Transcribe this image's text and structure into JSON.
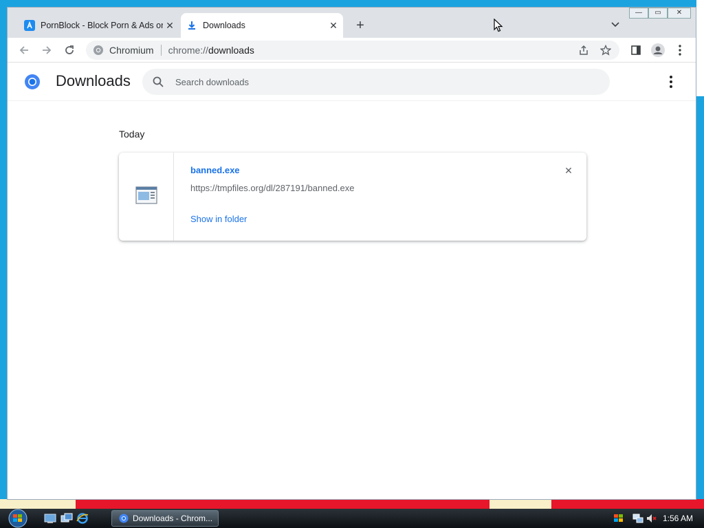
{
  "window": {
    "tabs": [
      {
        "title": "PornBlock - Block Porn & Ads on",
        "active": false
      },
      {
        "title": "Downloads",
        "active": true
      }
    ],
    "new_tab": "+",
    "tab_list": "⌄",
    "controls": {
      "minimize": "—",
      "maximize": "▭",
      "close": "✕"
    }
  },
  "toolbar": {
    "site_name": "Chromium",
    "url_prefix": "chrome://",
    "url_path": "downloads"
  },
  "page": {
    "title": "Downloads",
    "search_placeholder": "Search downloads",
    "date_group": "Today",
    "downloads": [
      {
        "file_name": "banned.exe",
        "url": "https://tmpfiles.org/dl/287191/banned.exe",
        "action": "Show in folder",
        "remove": "✕"
      }
    ]
  },
  "taskbar": {
    "task_label": "Downloads - Chrom...",
    "clock": "1:56 AM"
  },
  "colors": {
    "accent": "#1a73e8",
    "desktop": "#1ba3e0",
    "tabstrip": "#dee1e6"
  }
}
